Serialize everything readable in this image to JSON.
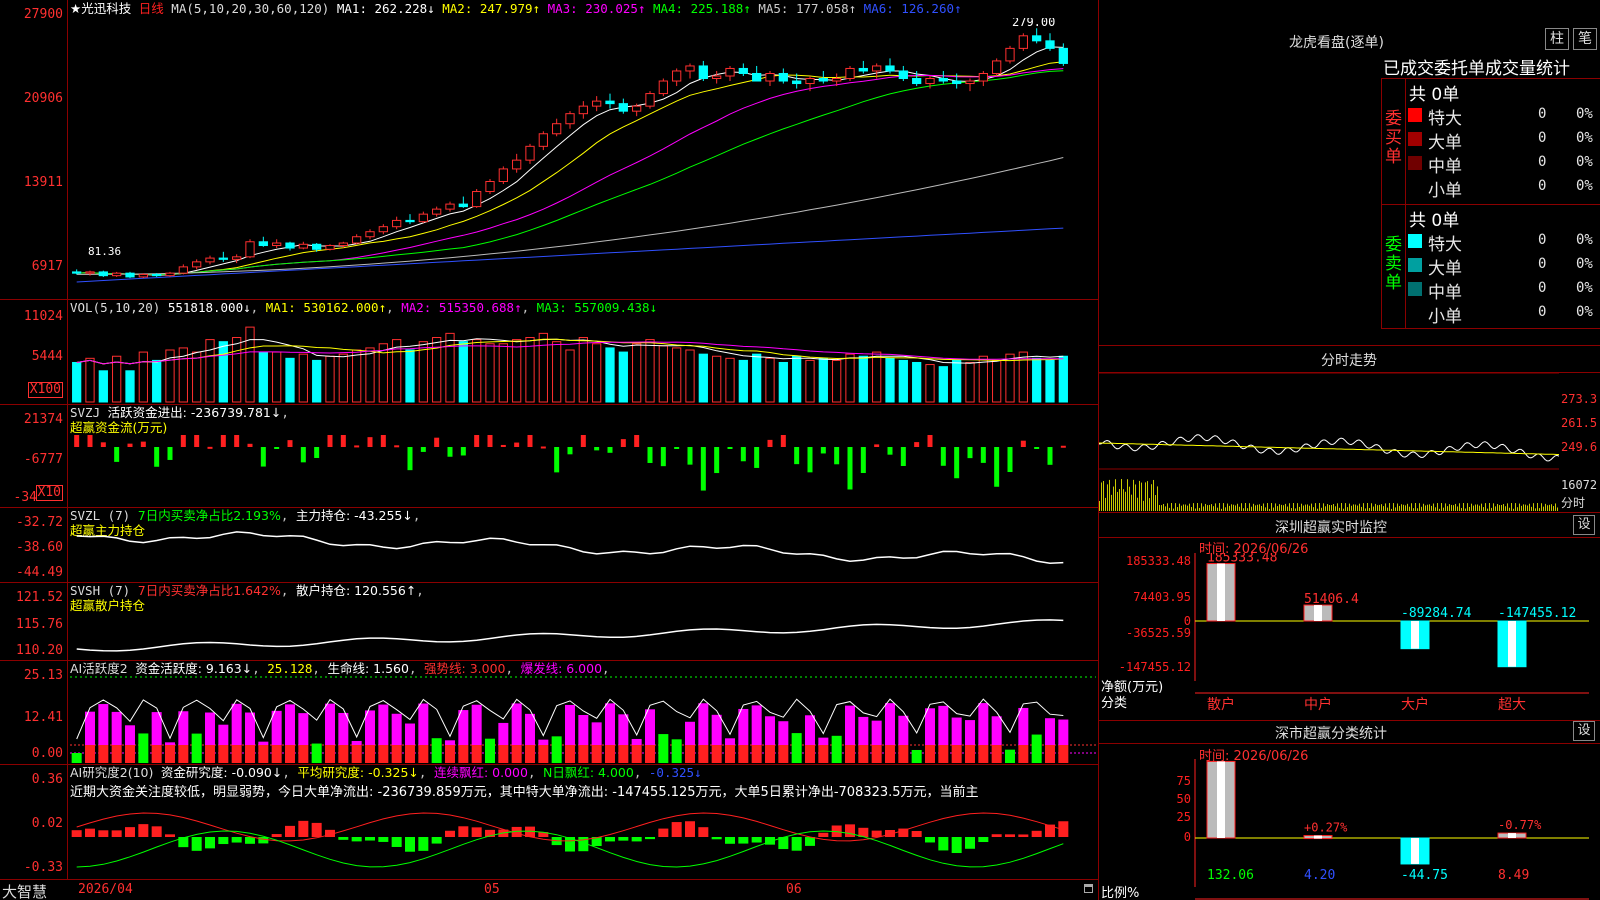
{
  "stock": {
    "name": "★光迅科技",
    "period": "日线"
  },
  "ma": {
    "label": "MA(5,10,20,30,60,120)",
    "items": [
      {
        "text": "MA1: 262.228↓",
        "color": "#ffffff"
      },
      {
        "text": "MA2: 247.979↑",
        "color": "#ffff00"
      },
      {
        "text": "MA3: 230.025↑",
        "color": "#ff00ff"
      },
      {
        "text": "MA4: 225.188↑",
        "color": "#00ff00"
      },
      {
        "text": "MA5: 177.058↑",
        "color": "#cccccc"
      },
      {
        "text": "MA6: 126.260↑",
        "color": "#3050ff"
      }
    ]
  },
  "price_axis": [
    "27900",
    "20906",
    "13911",
    "6917"
  ],
  "price_marks": {
    "high": "279.00",
    "low": "81.36"
  },
  "vol": {
    "label": "VOL(5,10,20)",
    "value": "551818.000↓",
    "ma1": "MA1: 530162.000↑",
    "ma2": "MA2: 515350.688↑",
    "ma3": "MA3: 557009.438↓",
    "axis": [
      "11024",
      "5444"
    ],
    "unit": "X100"
  },
  "svzj": {
    "label": "SVZJ",
    "desc": "活跃资金进出: -236739.781↓",
    "sub": "超赢资金流(万元)",
    "axis": [
      "21374",
      "-6777",
      "-34"
    ],
    "unit": "X10"
  },
  "svzl": {
    "label": "SVZL (7)",
    "desc": "7日内买卖净占比2.193%",
    "hold": "主力持仓: -43.255↓",
    "sub": "超赢主力持仓",
    "axis": [
      "-32.72",
      "-38.60",
      "-44.49"
    ]
  },
  "svsh": {
    "label": "SVSH (7)",
    "desc": "7日内买卖净占比1.642%",
    "hold": "散户持仓: 120.556↑",
    "sub": "超赢散户持仓",
    "axis": [
      "121.52",
      "115.76",
      "110.20"
    ]
  },
  "ai1": {
    "label": "AI活跃度2",
    "v1": "资金活跃度: 9.163↓",
    "v2": "25.128",
    "v3": "生命线: 1.560",
    "v4": "强势线: 3.000",
    "v5": "爆发线: 6.000",
    "axis": [
      "25.13",
      "12.41",
      "0.00"
    ]
  },
  "ai2": {
    "label": "AI研究度2(10)",
    "v1": "资金研究度: -0.090↓",
    "v2": "平均研究度: -0.325↓",
    "v3": "连续飘红: 0.000",
    "v4": "N日飘红: 4.000",
    "v5": "-0.325↓",
    "text": "近期大资金关注度较低，明显弱势，今日大单净流出: -236739.859万元，其中特大单净流出: -147455.125万元，大单5日累计净出-708323.5万元，当前主",
    "axis": [
      "0.36",
      "0.02",
      "-0.33"
    ]
  },
  "bottom": {
    "brand": "大智慧",
    "date": "2026/04",
    "m5": "05",
    "m6": "06"
  },
  "lhb": {
    "title": "龙虎看盘(逐单)",
    "btn1": "柱",
    "btn2": "笔",
    "head": "已成交委托单成交量统计",
    "buy_label": "委买单",
    "sell_label": "委卖单",
    "buy_total": "共 0单",
    "sell_total": "共 0单",
    "buy_rows": [
      {
        "name": "特大",
        "count": "0",
        "pct": "0%",
        "color": "#ff0000"
      },
      {
        "name": "大单",
        "count": "0",
        "pct": "0%",
        "color": "#a00000"
      },
      {
        "name": "中单",
        "count": "0",
        "pct": "0%",
        "color": "#700000"
      },
      {
        "name": "小单",
        "count": "0",
        "pct": "0%",
        "color": "#000000"
      }
    ],
    "sell_rows": [
      {
        "name": "特大",
        "count": "0",
        "pct": "0%",
        "color": "#00ffff"
      },
      {
        "name": "大单",
        "count": "0",
        "pct": "0%",
        "color": "#00a0a0"
      },
      {
        "name": "中单",
        "count": "0",
        "pct": "0%",
        "color": "#007070"
      },
      {
        "name": "小单",
        "count": "0",
        "pct": "0%",
        "color": "#000000"
      }
    ]
  },
  "intraday": {
    "title": "分时走势",
    "axis": [
      "273.3",
      "261.5",
      "249.6"
    ],
    "vol_label": "16072",
    "unit": "分时"
  },
  "sz_monitor": {
    "title": "深圳超赢实时监控",
    "btn": "设",
    "time": "时间: 2026/06/26",
    "axis": [
      "185333.48",
      "74403.95",
      "0",
      "-36525.59",
      "-147455.12"
    ],
    "ylabel": "净额(万元)",
    "xlabel": "分类",
    "bars": [
      {
        "cat": "散户",
        "value": 185333.48,
        "label": "185333.48"
      },
      {
        "cat": "中户",
        "value": 51406.4,
        "label": "51406.4"
      },
      {
        "cat": "大户",
        "value": -89284.74,
        "label": "-89284.74"
      },
      {
        "cat": "超大",
        "value": -147455.12,
        "label": "-147455.12"
      }
    ]
  },
  "sz_class": {
    "title": "深市超赢分类统计",
    "btn": "设",
    "time": "时间: 2026/06/26",
    "axis": [
      "75",
      "50",
      "25",
      "0"
    ],
    "ylabel": "比例%",
    "xlabel": "分类",
    "bars": [
      {
        "cat": "散户",
        "value": 132.06,
        "label": "132.06",
        "top": ""
      },
      {
        "cat": "中户",
        "value": 4.2,
        "label": "4.20",
        "top": "+0.27%"
      },
      {
        "cat": "大户",
        "value": -44.75,
        "label": "-44.75",
        "top": ""
      },
      {
        "cat": "超大",
        "value": 8.49,
        "label": "8.49",
        "top": "-0.77%"
      }
    ]
  },
  "chart_data": {
    "type": "candlestick",
    "candles": [
      [
        86,
        88,
        84,
        85
      ],
      [
        85,
        87,
        83,
        86
      ],
      [
        86,
        87,
        82,
        83
      ],
      [
        83,
        86,
        82,
        85
      ],
      [
        85,
        86,
        81,
        82
      ],
      [
        82,
        85,
        81,
        84
      ],
      [
        84,
        85,
        82,
        83
      ],
      [
        83,
        86,
        82,
        85
      ],
      [
        85,
        92,
        84,
        90
      ],
      [
        90,
        96,
        88,
        94
      ],
      [
        94,
        99,
        92,
        97
      ],
      [
        97,
        102,
        94,
        96
      ],
      [
        96,
        100,
        93,
        98
      ],
      [
        98,
        112,
        97,
        110
      ],
      [
        110,
        114,
        106,
        107
      ],
      [
        107,
        112,
        105,
        109
      ],
      [
        109,
        110,
        103,
        105
      ],
      [
        105,
        110,
        104,
        108
      ],
      [
        108,
        109,
        102,
        104
      ],
      [
        104,
        108,
        103,
        107
      ],
      [
        107,
        110,
        105,
        109
      ],
      [
        109,
        116,
        108,
        114
      ],
      [
        114,
        120,
        112,
        118
      ],
      [
        118,
        124,
        116,
        122
      ],
      [
        122,
        130,
        120,
        127
      ],
      [
        127,
        132,
        124,
        126
      ],
      [
        126,
        134,
        125,
        132
      ],
      [
        132,
        138,
        130,
        136
      ],
      [
        136,
        142,
        134,
        140
      ],
      [
        140,
        146,
        137,
        138
      ],
      [
        138,
        152,
        137,
        150
      ],
      [
        150,
        160,
        148,
        158
      ],
      [
        158,
        170,
        156,
        168
      ],
      [
        168,
        180,
        165,
        175
      ],
      [
        175,
        188,
        172,
        186
      ],
      [
        186,
        198,
        183,
        196
      ],
      [
        196,
        208,
        194,
        204
      ],
      [
        204,
        214,
        200,
        212
      ],
      [
        212,
        222,
        208,
        218
      ],
      [
        218,
        226,
        214,
        222
      ],
      [
        222,
        228,
        216,
        220
      ],
      [
        220,
        224,
        212,
        214
      ],
      [
        214,
        220,
        210,
        218
      ],
      [
        218,
        230,
        216,
        228
      ],
      [
        228,
        240,
        226,
        238
      ],
      [
        238,
        248,
        234,
        246
      ],
      [
        246,
        252,
        240,
        250
      ],
      [
        250,
        254,
        238,
        240
      ],
      [
        240,
        246,
        236,
        242
      ],
      [
        242,
        250,
        238,
        248
      ],
      [
        248,
        252,
        242,
        244
      ],
      [
        244,
        250,
        240,
        238
      ],
      [
        238,
        246,
        234,
        244
      ],
      [
        244,
        248,
        236,
        238
      ],
      [
        238,
        244,
        232,
        236
      ],
      [
        236,
        242,
        230,
        240
      ],
      [
        240,
        246,
        236,
        238
      ],
      [
        238,
        244,
        234,
        240
      ],
      [
        240,
        250,
        238,
        248
      ],
      [
        248,
        254,
        244,
        246
      ],
      [
        246,
        252,
        240,
        250
      ],
      [
        250,
        256,
        244,
        246
      ],
      [
        246,
        250,
        238,
        240
      ],
      [
        240,
        246,
        234,
        236
      ],
      [
        236,
        242,
        232,
        240
      ],
      [
        240,
        246,
        236,
        238
      ],
      [
        238,
        244,
        232,
        236
      ],
      [
        236,
        240,
        230,
        238
      ],
      [
        238,
        246,
        234,
        244
      ],
      [
        244,
        256,
        242,
        254
      ],
      [
        254,
        266,
        252,
        264
      ],
      [
        264,
        276,
        262,
        274
      ],
      [
        274,
        280,
        268,
        270
      ],
      [
        270,
        276,
        262,
        264
      ],
      [
        264,
        268,
        250,
        252
      ]
    ],
    "volume": [
      38,
      42,
      30,
      44,
      30,
      48,
      40,
      50,
      52,
      48,
      60,
      58,
      62,
      72,
      48,
      48,
      42,
      46,
      40,
      44,
      46,
      50,
      52,
      56,
      60,
      50,
      58,
      62,
      66,
      58,
      60,
      56,
      56,
      60,
      62,
      66,
      58,
      50,
      62,
      56,
      52,
      48,
      56,
      60,
      54,
      52,
      50,
      46,
      44,
      42,
      40,
      46,
      42,
      38,
      44,
      40,
      42,
      40,
      46,
      44,
      48,
      42,
      40,
      38,
      36,
      34,
      40,
      38,
      44,
      40,
      46,
      48,
      42,
      40,
      44
    ]
  }
}
